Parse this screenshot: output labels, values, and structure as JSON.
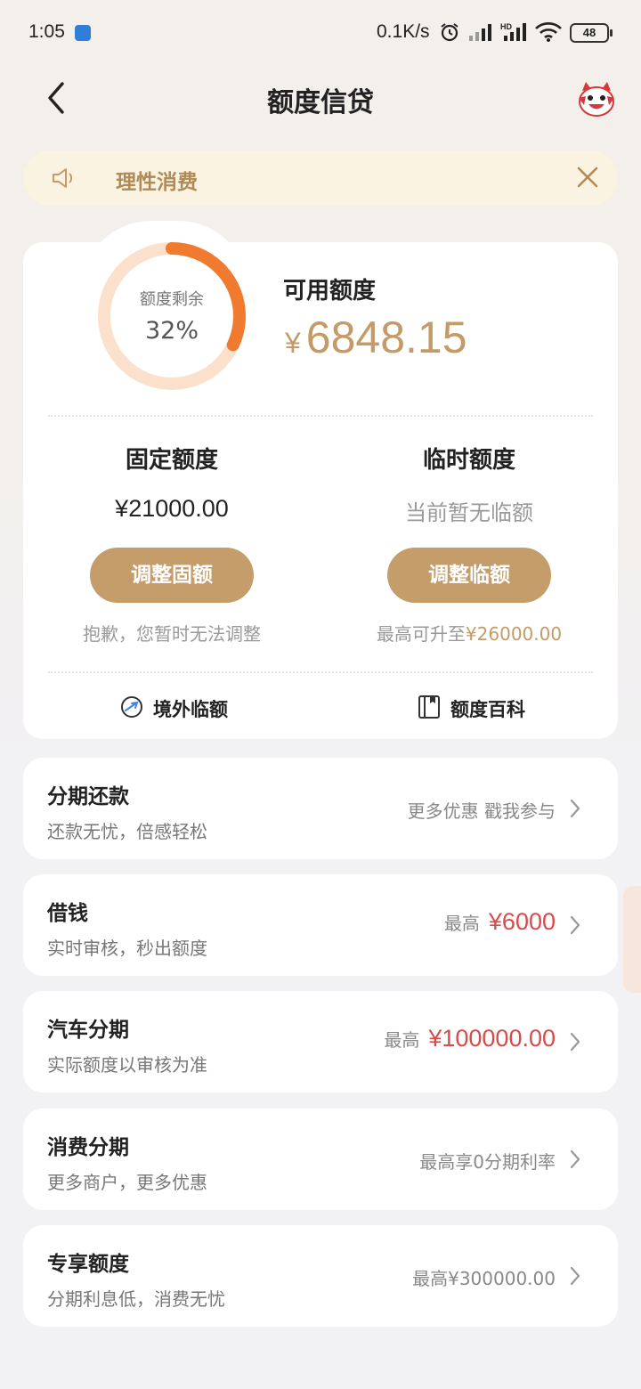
{
  "status_bar": {
    "time": "1:05",
    "net_speed": "0.1K/s",
    "battery": "48"
  },
  "nav": {
    "title": "额度信贷"
  },
  "notice": {
    "text": "理性消费"
  },
  "summary": {
    "ring_label": "额度剩余",
    "ring_percent": "32%",
    "ring_fraction": 0.32,
    "available_label": "可用额度",
    "available_currency": "¥",
    "available_amount": "6848.15"
  },
  "fixed": {
    "title": "固定额度",
    "amount": "¥21000.00",
    "button": "调整固额",
    "note": "抱歉，您暂时无法调整"
  },
  "temp": {
    "title": "临时额度",
    "status": "当前暂无临额",
    "button": "调整临额",
    "note_prefix": "最高可升至",
    "note_amount": "¥26000.00"
  },
  "links": {
    "overseas": "境外临额",
    "wiki": "额度百科"
  },
  "rows": [
    {
      "title": "分期还款",
      "subtitle": "还款无忧，倍感轻松",
      "right_text": "更多优惠 戳我参与",
      "right_highlight": ""
    },
    {
      "title": "借钱",
      "subtitle": "实时审核，秒出额度",
      "right_text": "最高",
      "right_highlight": "¥6000"
    },
    {
      "title": "汽车分期",
      "subtitle": "实际额度以审核为准",
      "right_text": "最高",
      "right_highlight": "¥100000.00"
    },
    {
      "title": "消费分期",
      "subtitle": "更多商户，更多优惠",
      "right_text": "最高享0分期利率",
      "right_highlight": ""
    },
    {
      "title": "专享额度",
      "subtitle": "分期利息低，消费无忧",
      "right_text": "最高¥300000.00",
      "right_highlight": ""
    }
  ],
  "colors": {
    "accent_gold": "#c59d6b",
    "ring_orange": "#f07a2e",
    "ring_track": "#fbe0cc",
    "highlight_red": "#d94b4b"
  }
}
